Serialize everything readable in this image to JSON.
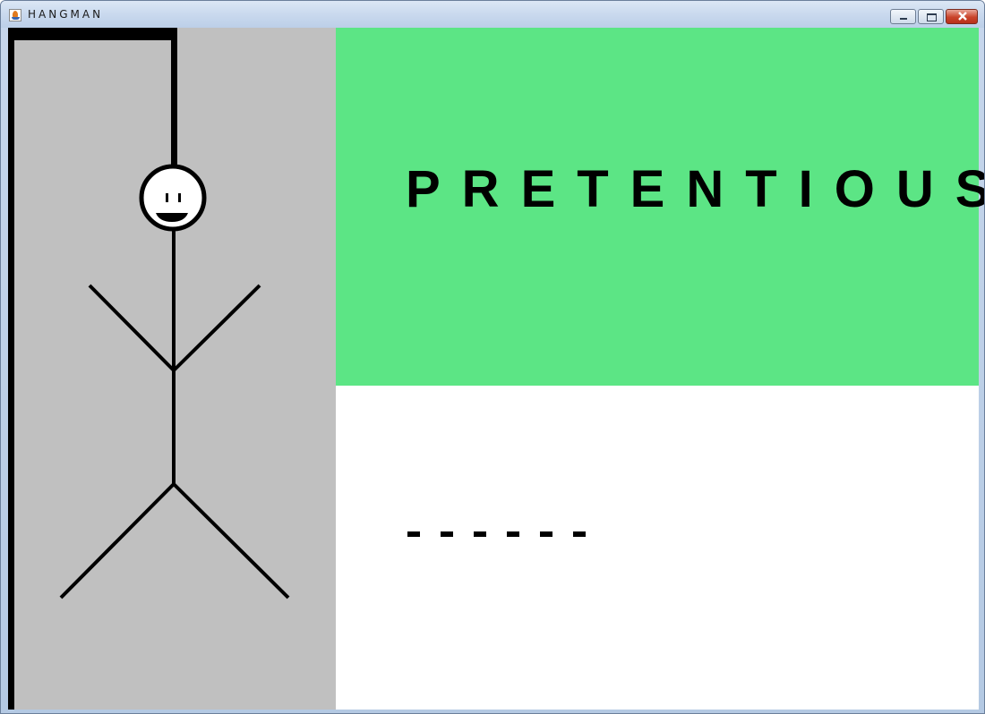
{
  "window": {
    "title": "HANGMAN",
    "app_icon": "java-icon",
    "buttons": {
      "minimize": "minimize-icon",
      "maximize": "maximize-icon",
      "close": "close-icon"
    }
  },
  "game": {
    "word": "PRETENTIOUS",
    "blanks": [
      "-",
      "-",
      "-",
      "-",
      "-",
      "-"
    ],
    "colors": {
      "word_panel": "#5ce585",
      "gallows_panel": "#c0c0c0",
      "guess_panel": "#ffffff",
      "ink": "#000000"
    }
  }
}
